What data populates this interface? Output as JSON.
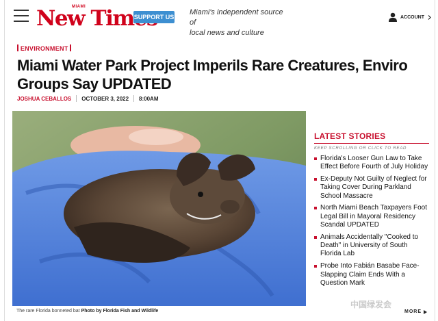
{
  "header": {
    "logo_small": "MIAMI",
    "logo_name": "New Times",
    "support_label": "SUPPORT US",
    "tagline_line1": "Miami's independent source of",
    "tagline_line2": "local news and culture",
    "account_label": "ACCOUNT",
    "brand_color": "#d0021b"
  },
  "article": {
    "category": "ENVIRONMENT",
    "headline": "Miami Water Park Project Imperils Rare Creatures, Enviro Groups Say UPDATED",
    "author": "JOSHUA CEBALLOS",
    "date": "OCTOBER 3, 2022",
    "time": "8:00AM",
    "caption_text": "The rare Florida bonneted bat",
    "caption_credit": "Photo by Florida Fish and Wildlife"
  },
  "sidebar": {
    "title": "LATEST STORIES",
    "subtitle": "KEEP SCROLLING OR CLICK TO READ",
    "stories": [
      "Florida's Looser Gun Law to Take Effect Before Fourth of July Holiday",
      "Ex-Deputy Not Guilty of Neglect for Taking Cover During Parkland School Massacre",
      "North Miami Beach Taxpayers Foot Legal Bill in Mayoral Residency Scandal UPDATED",
      "Animals Accidentally \"Cooked to Death\" in University of South Florida Lab",
      "Probe Into Fabián Basabe Face-Slapping Claim Ends With a Question Mark"
    ],
    "more_label": "MORE"
  },
  "watermark": "中国绿发会"
}
